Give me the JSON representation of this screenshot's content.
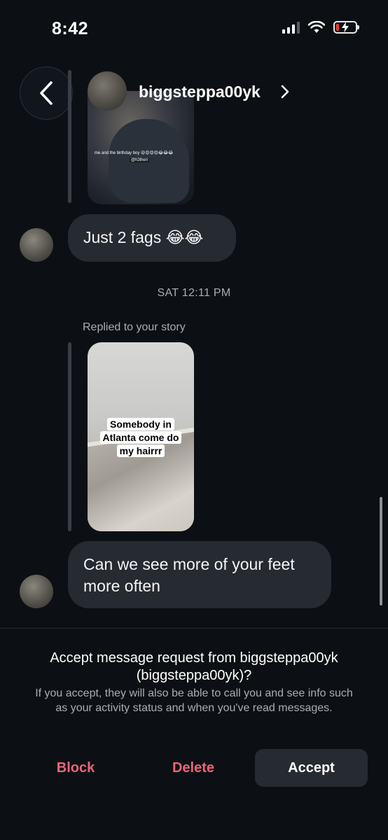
{
  "status_bar": {
    "time": "8:42"
  },
  "header": {
    "username": "biggsteppa00yk"
  },
  "thread": {
    "story1_caption": "me and the birthday boy 😝😍😍😍😂😂😂",
    "story1_tag": "@h3lheri",
    "message1": "Just 2 fags 😂😂",
    "timestamp": "SAT 12:11 PM",
    "replied_label": "Replied to your story",
    "story2_text_line1": "Somebody in",
    "story2_text_line2": "Atlanta come do",
    "story2_text_line3": "my hairrr",
    "message2": "Can we see more of your feet more often"
  },
  "request_panel": {
    "title": "Accept message request from biggsteppa00yk (biggsteppa00yk)?",
    "subtitle": "If you accept, they will also be able to call you and see info such as your activity status and when you've read messages.",
    "block_label": "Block",
    "delete_label": "Delete",
    "accept_label": "Accept"
  }
}
